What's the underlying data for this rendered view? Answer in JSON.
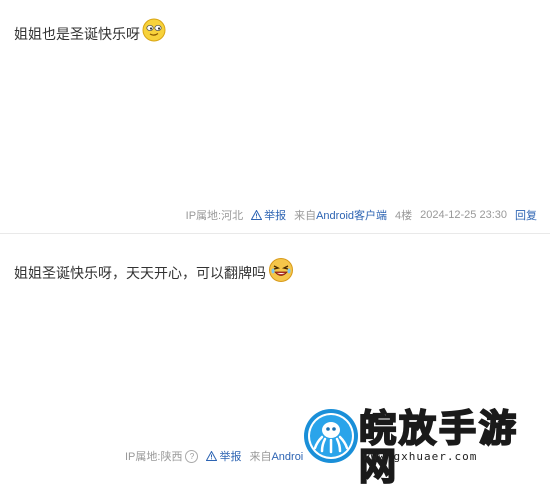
{
  "posts": [
    {
      "text": "姐姐也是圣诞快乐呀",
      "emoji": "sly-smile-emoji",
      "ip": "IP属地:河北",
      "report": "举报",
      "client_prefix": "来自",
      "client_link": "Android客户端",
      "floor": "4楼",
      "time": "2024-12-25 23:30",
      "reply": "回复"
    },
    {
      "text": "姐姐圣诞快乐呀，天天开心，可以翻牌吗",
      "emoji": "laughing-cry-emoji",
      "ip": "IP属地:陕西",
      "report": "举报",
      "client_prefix": "来自",
      "client_link": "Androi"
    }
  ],
  "watermark": {
    "title": "皖放手游网",
    "url": "www.gxhuaer.com"
  },
  "colors": {
    "link": "#2d64b3",
    "meta": "#999999",
    "text": "#333333"
  }
}
